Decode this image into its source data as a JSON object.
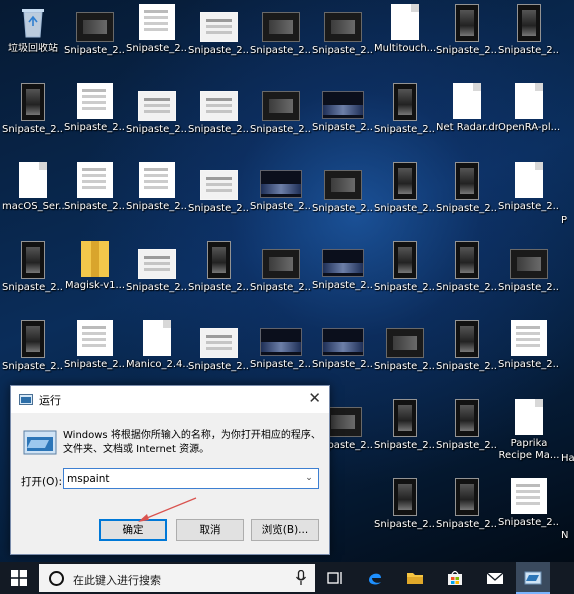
{
  "desktop": {
    "icons": [
      {
        "label": "垃圾回收站",
        "kind": "bin"
      },
      {
        "label": "Snipaste_2...",
        "kind": "dark"
      },
      {
        "label": "Snipaste_2...",
        "kind": "white"
      },
      {
        "label": "Snipaste_2...",
        "kind": "light"
      },
      {
        "label": "Snipaste_2...",
        "kind": "dark"
      },
      {
        "label": "Snipaste_2...",
        "kind": "dark"
      },
      {
        "label": "Multitouch...",
        "kind": "doc"
      },
      {
        "label": "Snipaste_2...",
        "kind": "phone"
      },
      {
        "label": "Snipaste_2...",
        "kind": "phone"
      },
      {
        "label": "Snipaste_2...",
        "kind": "phone"
      },
      {
        "label": "Snipaste_2...",
        "kind": "white"
      },
      {
        "label": "Snipaste_2...",
        "kind": "light"
      },
      {
        "label": "Snipaste_2...",
        "kind": "light"
      },
      {
        "label": "Snipaste_2...",
        "kind": "dark"
      },
      {
        "label": "Snipaste_2...",
        "kind": "night"
      },
      {
        "label": "Snipaste_2...",
        "kind": "phone"
      },
      {
        "label": "Net Radar.dmg",
        "kind": "doc"
      },
      {
        "label": "OpenRA-pl...",
        "kind": "doc"
      },
      {
        "label": "macOS_Ser...",
        "kind": "doc"
      },
      {
        "label": "Snipaste_2...",
        "kind": "white"
      },
      {
        "label": "Snipaste_2...",
        "kind": "white"
      },
      {
        "label": "Snipaste_2...",
        "kind": "light"
      },
      {
        "label": "Snipaste_2...",
        "kind": "night"
      },
      {
        "label": "Snipaste_2...",
        "kind": "dark"
      },
      {
        "label": "Snipaste_2...",
        "kind": "phone"
      },
      {
        "label": "Snipaste_2...",
        "kind": "phone"
      },
      {
        "label": "Snipaste_2...",
        "kind": "doc"
      },
      {
        "label": "Snipaste_2...",
        "kind": "phone"
      },
      {
        "label": "Magisk-v1...",
        "kind": "yellow"
      },
      {
        "label": "Snipaste_2...",
        "kind": "light"
      },
      {
        "label": "Snipaste_2...",
        "kind": "phone"
      },
      {
        "label": "Snipaste_2...",
        "kind": "dark"
      },
      {
        "label": "Snipaste_2...",
        "kind": "night"
      },
      {
        "label": "Snipaste_2...",
        "kind": "phone"
      },
      {
        "label": "Snipaste_2...",
        "kind": "phone"
      },
      {
        "label": "Snipaste_2...",
        "kind": "dark"
      },
      {
        "label": "Snipaste_2...",
        "kind": "phone"
      },
      {
        "label": "Snipaste_2...",
        "kind": "white"
      },
      {
        "label": "Manico_2.4...",
        "kind": "doc"
      },
      {
        "label": "Snipaste_2...",
        "kind": "light"
      },
      {
        "label": "Snipaste_2...",
        "kind": "night"
      },
      {
        "label": "Snipaste_2...",
        "kind": "night"
      },
      {
        "label": "Snipaste_2...",
        "kind": "dark"
      },
      {
        "label": "Snipaste_2...",
        "kind": "phone"
      },
      {
        "label": "Snipaste_2...",
        "kind": "white"
      },
      {
        "label": "Snipaste_2...",
        "kind": "dark"
      },
      {
        "label": "Snipaste_2...",
        "kind": "phone"
      },
      {
        "label": "Snipaste_2...",
        "kind": "phone"
      },
      {
        "label": "Paprika Recipe Ma...",
        "kind": "doc"
      },
      {
        "label": "Snipaste_2...",
        "kind": "phone"
      },
      {
        "label": "Snipaste_2...",
        "kind": "phone"
      },
      {
        "label": "Snipaste_2...",
        "kind": "white"
      }
    ],
    "edge_labels": [
      "P",
      "Ha",
      "N"
    ]
  },
  "run_dialog": {
    "title": "运行",
    "description": "Windows 将根据你所输入的名称，为你打开相应的程序、文件夹、文档或 Internet 资源。",
    "open_label": "打开(O):",
    "open_value": "mspaint",
    "ok_label": "确定",
    "cancel_label": "取消",
    "browse_label": "浏览(B)..."
  },
  "taskbar": {
    "search_placeholder": "在此键入进行搜索"
  },
  "colors": {
    "accent": "#0078d7",
    "annotation_arrow": "#d9534f"
  }
}
